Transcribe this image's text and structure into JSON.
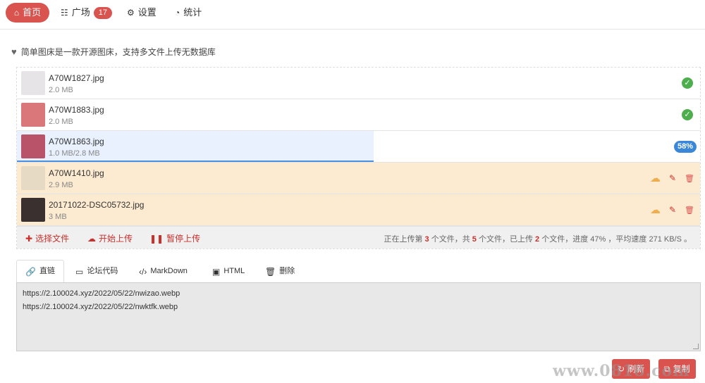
{
  "nav": {
    "home": {
      "icon": "home-icon",
      "label": "首页"
    },
    "plaza": {
      "icon": "grid-icon",
      "label": "广场",
      "badge": "17"
    },
    "settings": {
      "icon": "gears-icon",
      "label": "设置"
    },
    "stats": {
      "icon": "pie-chart-icon",
      "label": "统计"
    }
  },
  "description": {
    "icon": "heart-icon",
    "text": "简单图床是一款开源图床，支持多文件上传无数据库"
  },
  "files": [
    {
      "name": "A70W1827.jpg",
      "size": "2.0 MB",
      "status": "done",
      "thumb_color": "#e7e4e8"
    },
    {
      "name": "A70W1883.jpg",
      "size": "2.0 MB",
      "status": "done",
      "thumb_color": "#d9777a"
    },
    {
      "name": "A70W1863.jpg",
      "size": "1.0 MB/2.8 MB",
      "status": "uploading",
      "progress": 58,
      "progress_label": "58%",
      "thumb_color": "#b9536a"
    },
    {
      "name": "A70W1410.jpg",
      "size": "2.9 MB",
      "status": "pending",
      "thumb_color": "#e6dac4"
    },
    {
      "name": "20171022-DSC05732.jpg",
      "size": "3 MB",
      "status": "pending",
      "thumb_color": "#3a3030"
    }
  ],
  "toolbar": {
    "add_label": "选择文件",
    "start_label": "开始上传",
    "pause_label": "暂停上传",
    "status": {
      "p1": "正在上传第",
      "current": "3",
      "p2": "个文件，共",
      "total": "5",
      "p3": "个文件，已上传",
      "uploaded": "2",
      "p4": "个文件，进度",
      "progress": "47%",
      "p5": "，平均速度",
      "speed": "271 KB/S",
      "p6": "。"
    }
  },
  "tabs": {
    "direct": "直链",
    "forum": "论坛代码",
    "markdown": "MarkDown",
    "html": "HTML",
    "delete": "删除"
  },
  "links": [
    "https://2.100024.xyz/2022/05/22/nwizao.webp",
    "https://2.100024.xyz/2022/05/22/nwktfk.webp"
  ],
  "buttons": {
    "refresh": "刷新",
    "copy": "复制"
  },
  "watermark": "www.0818.com",
  "colors": {
    "accent": "#d9534f",
    "success": "#4cae4c",
    "progress": "#3a87d8",
    "pending_bg": "#fcebd0"
  }
}
